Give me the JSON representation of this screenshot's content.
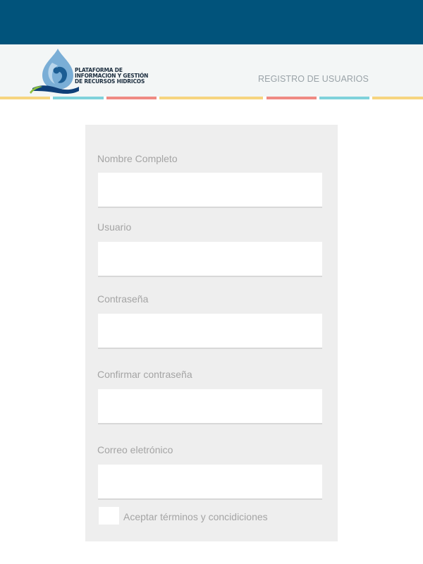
{
  "logo": {
    "lines": [
      "PLATAFORMA DE",
      "INFORMACION Y GESTIÓN",
      "DE RECURSOS HIDRICOS"
    ]
  },
  "nav": {
    "register_link": "REGISTRO DE USUARIOS"
  },
  "colors": {
    "topbar": "#01537b",
    "header_bg": "#f3f6f6",
    "stripe_yellow": "#f6d57f",
    "stripe_cyan": "#7fd2db",
    "stripe_red": "#ef8a83",
    "panel_bg": "#eeeeee"
  },
  "form": {
    "fields": [
      {
        "label": "Nombre Completo",
        "value": "",
        "placeholder": ""
      },
      {
        "label": "Usuario",
        "value": "",
        "placeholder": ""
      },
      {
        "label": "Contraseña",
        "value": "",
        "placeholder": ""
      },
      {
        "label": "Confirmar contraseña",
        "value": "",
        "placeholder": ""
      },
      {
        "label": "Correo eletrónico",
        "value": "",
        "placeholder": ""
      }
    ],
    "terms_label": "Aceptar términos y concidiciones"
  }
}
